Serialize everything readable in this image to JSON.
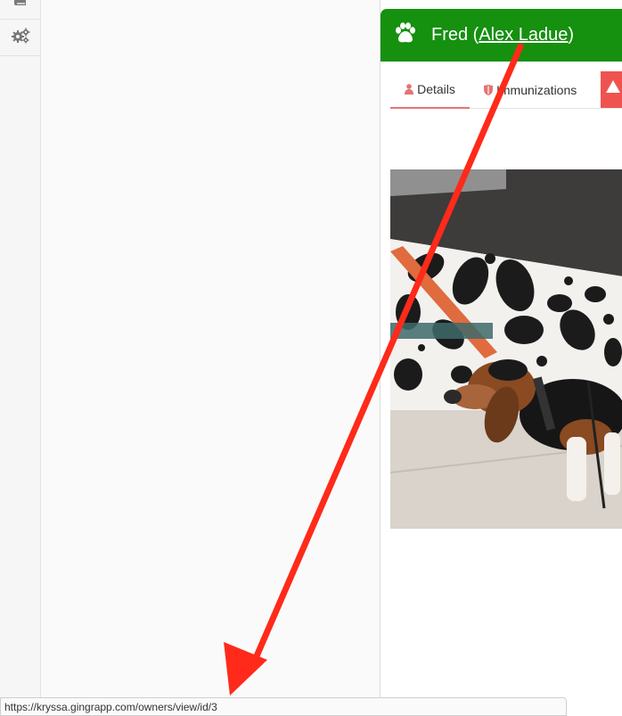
{
  "sidebar": {
    "items": [
      {
        "icon": "book-icon"
      },
      {
        "icon": "gears-icon"
      }
    ]
  },
  "pet_panel": {
    "header": {
      "pet_name": "Fred",
      "open_paren": " (",
      "owner_name": "Alex Ladue",
      "close_paren": ")",
      "icon": "paw-icon",
      "bg_color": "#15900f"
    },
    "tabs": [
      {
        "label": "Details",
        "icon": "person-icon",
        "active": true
      },
      {
        "label": "Immunizations",
        "icon": "shield-icon",
        "active": false
      },
      {
        "label": "",
        "icon": "warning-icon",
        "active": false,
        "color": "#ef5350"
      }
    ],
    "photo": {
      "subject": "basset hound on leash in front of mural"
    }
  },
  "status_bar": {
    "url": "https://kryssa.gingrapp.com/owners/view/id/3"
  },
  "annotation": {
    "color": "#ff2a1a"
  }
}
